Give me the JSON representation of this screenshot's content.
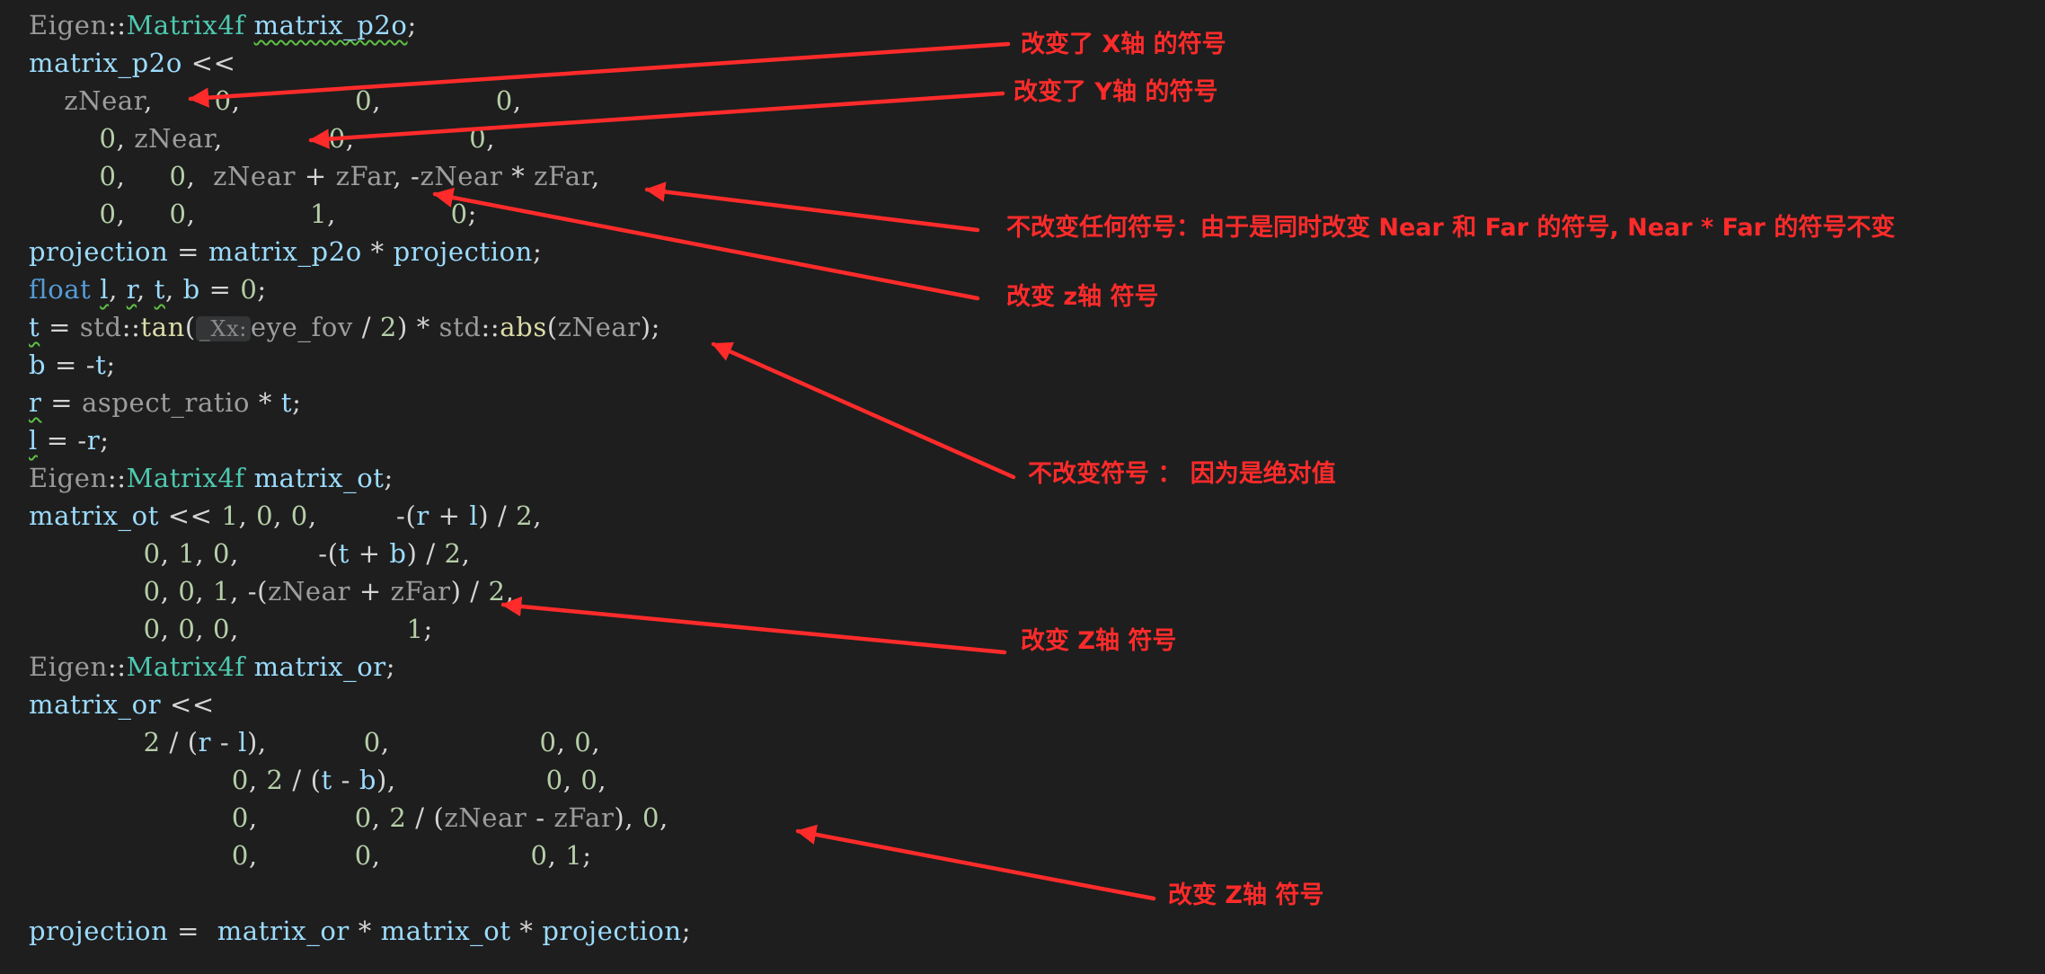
{
  "colors": {
    "background": "#1e1e1e",
    "annotation": "#ff2b2b",
    "namespace": "#9b9b9b",
    "type": "#4ec9b0",
    "variable": "#9cdcfe",
    "operator": "#d4d4d4",
    "number": "#b5cea8",
    "keyword": "#569cd6",
    "function": "#dcdcaa",
    "inlay_hint": "#8a8a8a",
    "squiggle": "#5fbf45"
  },
  "code_lines": [
    [
      {
        "t": "Eigen",
        "c": "ns"
      },
      {
        "t": "::",
        "c": "op"
      },
      {
        "t": "Matrix4f",
        "c": "type"
      },
      {
        "t": " ",
        "c": "op"
      },
      {
        "t": "matrix_p2o",
        "c": "var",
        "sq": true
      },
      {
        "t": ";",
        "c": "op"
      }
    ],
    [
      {
        "t": "matrix_p2o",
        "c": "var"
      },
      {
        "t": " <<",
        "c": "op"
      }
    ],
    [
      {
        "t": "    ",
        "c": "op"
      },
      {
        "t": "zNear",
        "c": "dim"
      },
      {
        "t": ",       ",
        "c": "op"
      },
      {
        "t": "0",
        "c": "num"
      },
      {
        "t": ",             ",
        "c": "op"
      },
      {
        "t": "0",
        "c": "num"
      },
      {
        "t": ",             ",
        "c": "op"
      },
      {
        "t": "0",
        "c": "num"
      },
      {
        "t": ",",
        "c": "op"
      }
    ],
    [
      {
        "t": "        ",
        "c": "op"
      },
      {
        "t": "0",
        "c": "num"
      },
      {
        "t": ", ",
        "c": "op"
      },
      {
        "t": "zNear",
        "c": "dim"
      },
      {
        "t": ",            ",
        "c": "op"
      },
      {
        "t": "0",
        "c": "num"
      },
      {
        "t": ",             ",
        "c": "op"
      },
      {
        "t": "0",
        "c": "num"
      },
      {
        "t": ",",
        "c": "op"
      }
    ],
    [
      {
        "t": "        ",
        "c": "op"
      },
      {
        "t": "0",
        "c": "num"
      },
      {
        "t": ",     ",
        "c": "op"
      },
      {
        "t": "0",
        "c": "num"
      },
      {
        "t": ",  ",
        "c": "op"
      },
      {
        "t": "zNear",
        "c": "dim"
      },
      {
        "t": " + ",
        "c": "op"
      },
      {
        "t": "zFar",
        "c": "dim"
      },
      {
        "t": ", -",
        "c": "op"
      },
      {
        "t": "zNear",
        "c": "dim"
      },
      {
        "t": " * ",
        "c": "op"
      },
      {
        "t": "zFar",
        "c": "dim"
      },
      {
        "t": ",",
        "c": "op"
      }
    ],
    [
      {
        "t": "        ",
        "c": "op"
      },
      {
        "t": "0",
        "c": "num"
      },
      {
        "t": ",     ",
        "c": "op"
      },
      {
        "t": "0",
        "c": "num"
      },
      {
        "t": ",             ",
        "c": "op"
      },
      {
        "t": "1",
        "c": "num"
      },
      {
        "t": ",             ",
        "c": "op"
      },
      {
        "t": "0",
        "c": "num"
      },
      {
        "t": ";",
        "c": "op"
      }
    ],
    [
      {
        "t": "projection",
        "c": "var"
      },
      {
        "t": " = ",
        "c": "op"
      },
      {
        "t": "matrix_p2o",
        "c": "var"
      },
      {
        "t": " * ",
        "c": "op"
      },
      {
        "t": "projection",
        "c": "var"
      },
      {
        "t": ";",
        "c": "op"
      }
    ],
    [
      {
        "t": "float",
        "c": "kw"
      },
      {
        "t": " ",
        "c": "op"
      },
      {
        "t": "l",
        "c": "var",
        "sq": true
      },
      {
        "t": ", ",
        "c": "op"
      },
      {
        "t": "r",
        "c": "var",
        "sq": true
      },
      {
        "t": ", ",
        "c": "op"
      },
      {
        "t": "t",
        "c": "var",
        "sq": true
      },
      {
        "t": ", ",
        "c": "op"
      },
      {
        "t": "b",
        "c": "var"
      },
      {
        "t": " = ",
        "c": "op"
      },
      {
        "t": "0",
        "c": "num"
      },
      {
        "t": ";",
        "c": "op"
      }
    ],
    [
      {
        "t": "t",
        "c": "var",
        "sq": true
      },
      {
        "t": " = ",
        "c": "op"
      },
      {
        "t": "std",
        "c": "ns"
      },
      {
        "t": "::",
        "c": "op"
      },
      {
        "t": "tan",
        "c": "fn"
      },
      {
        "t": "(",
        "c": "op"
      },
      {
        "t": "_Xx:",
        "c": "hint"
      },
      {
        "t": "eye_fov",
        "c": "dim"
      },
      {
        "t": " / ",
        "c": "op"
      },
      {
        "t": "2",
        "c": "num"
      },
      {
        "t": ") * ",
        "c": "op"
      },
      {
        "t": "std",
        "c": "ns"
      },
      {
        "t": "::",
        "c": "op"
      },
      {
        "t": "abs",
        "c": "fn"
      },
      {
        "t": "(",
        "c": "op"
      },
      {
        "t": "zNear",
        "c": "dim"
      },
      {
        "t": ");",
        "c": "op"
      }
    ],
    [
      {
        "t": "b",
        "c": "var"
      },
      {
        "t": " = -",
        "c": "op"
      },
      {
        "t": "t",
        "c": "var"
      },
      {
        "t": ";",
        "c": "op"
      }
    ],
    [
      {
        "t": "r",
        "c": "var",
        "sq": true
      },
      {
        "t": " = ",
        "c": "op"
      },
      {
        "t": "aspect_ratio",
        "c": "dim"
      },
      {
        "t": " * ",
        "c": "op"
      },
      {
        "t": "t",
        "c": "var"
      },
      {
        "t": ";",
        "c": "op"
      }
    ],
    [
      {
        "t": "l",
        "c": "var",
        "sq": true
      },
      {
        "t": " = -",
        "c": "op"
      },
      {
        "t": "r",
        "c": "var"
      },
      {
        "t": ";",
        "c": "op"
      }
    ],
    [
      {
        "t": "Eigen",
        "c": "ns"
      },
      {
        "t": "::",
        "c": "op"
      },
      {
        "t": "Matrix4f",
        "c": "type"
      },
      {
        "t": " ",
        "c": "op"
      },
      {
        "t": "matrix_ot",
        "c": "var"
      },
      {
        "t": ";",
        "c": "op"
      }
    ],
    [
      {
        "t": "matrix_ot",
        "c": "var"
      },
      {
        "t": " << ",
        "c": "op"
      },
      {
        "t": "1",
        "c": "num"
      },
      {
        "t": ", ",
        "c": "op"
      },
      {
        "t": "0",
        "c": "num"
      },
      {
        "t": ", ",
        "c": "op"
      },
      {
        "t": "0",
        "c": "num"
      },
      {
        "t": ",         -(",
        "c": "op"
      },
      {
        "t": "r",
        "c": "var"
      },
      {
        "t": " + ",
        "c": "op"
      },
      {
        "t": "l",
        "c": "var"
      },
      {
        "t": ") / ",
        "c": "op"
      },
      {
        "t": "2",
        "c": "num"
      },
      {
        "t": ",",
        "c": "op"
      }
    ],
    [
      {
        "t": "             ",
        "c": "op"
      },
      {
        "t": "0",
        "c": "num"
      },
      {
        "t": ", ",
        "c": "op"
      },
      {
        "t": "1",
        "c": "num"
      },
      {
        "t": ", ",
        "c": "op"
      },
      {
        "t": "0",
        "c": "num"
      },
      {
        "t": ",         -(",
        "c": "op"
      },
      {
        "t": "t",
        "c": "var"
      },
      {
        "t": " + ",
        "c": "op"
      },
      {
        "t": "b",
        "c": "var"
      },
      {
        "t": ") / ",
        "c": "op"
      },
      {
        "t": "2",
        "c": "num"
      },
      {
        "t": ",",
        "c": "op"
      }
    ],
    [
      {
        "t": "             ",
        "c": "op"
      },
      {
        "t": "0",
        "c": "num"
      },
      {
        "t": ", ",
        "c": "op"
      },
      {
        "t": "0",
        "c": "num"
      },
      {
        "t": ", ",
        "c": "op"
      },
      {
        "t": "1",
        "c": "num"
      },
      {
        "t": ", -(",
        "c": "op"
      },
      {
        "t": "zNear",
        "c": "dim"
      },
      {
        "t": " + ",
        "c": "op"
      },
      {
        "t": "zFar",
        "c": "dim"
      },
      {
        "t": ") / ",
        "c": "op"
      },
      {
        "t": "2",
        "c": "num"
      },
      {
        "t": ",",
        "c": "op"
      }
    ],
    [
      {
        "t": "             ",
        "c": "op"
      },
      {
        "t": "0",
        "c": "num"
      },
      {
        "t": ", ",
        "c": "op"
      },
      {
        "t": "0",
        "c": "num"
      },
      {
        "t": ", ",
        "c": "op"
      },
      {
        "t": "0",
        "c": "num"
      },
      {
        "t": ",                   ",
        "c": "op"
      },
      {
        "t": "1",
        "c": "num"
      },
      {
        "t": ";",
        "c": "op"
      }
    ],
    [
      {
        "t": "Eigen",
        "c": "ns"
      },
      {
        "t": "::",
        "c": "op"
      },
      {
        "t": "Matrix4f",
        "c": "type"
      },
      {
        "t": " ",
        "c": "op"
      },
      {
        "t": "matrix_or",
        "c": "var"
      },
      {
        "t": ";",
        "c": "op"
      }
    ],
    [
      {
        "t": "matrix_or",
        "c": "var"
      },
      {
        "t": " <<",
        "c": "op"
      }
    ],
    [
      {
        "t": "             ",
        "c": "op"
      },
      {
        "t": "2",
        "c": "num"
      },
      {
        "t": " / (",
        "c": "op"
      },
      {
        "t": "r",
        "c": "var"
      },
      {
        "t": " - ",
        "c": "op"
      },
      {
        "t": "l",
        "c": "var"
      },
      {
        "t": "),           ",
        "c": "op"
      },
      {
        "t": "0",
        "c": "num"
      },
      {
        "t": ",                 ",
        "c": "op"
      },
      {
        "t": "0",
        "c": "num"
      },
      {
        "t": ", ",
        "c": "op"
      },
      {
        "t": "0",
        "c": "num"
      },
      {
        "t": ",",
        "c": "op"
      }
    ],
    [
      {
        "t": "                       ",
        "c": "op"
      },
      {
        "t": "0",
        "c": "num"
      },
      {
        "t": ", ",
        "c": "op"
      },
      {
        "t": "2",
        "c": "num"
      },
      {
        "t": " / (",
        "c": "op"
      },
      {
        "t": "t",
        "c": "var"
      },
      {
        "t": " - ",
        "c": "op"
      },
      {
        "t": "b",
        "c": "var"
      },
      {
        "t": "),                 ",
        "c": "op"
      },
      {
        "t": "0",
        "c": "num"
      },
      {
        "t": ", ",
        "c": "op"
      },
      {
        "t": "0",
        "c": "num"
      },
      {
        "t": ",",
        "c": "op"
      }
    ],
    [
      {
        "t": "                       ",
        "c": "op"
      },
      {
        "t": "0",
        "c": "num"
      },
      {
        "t": ",           ",
        "c": "op"
      },
      {
        "t": "0",
        "c": "num"
      },
      {
        "t": ", ",
        "c": "op"
      },
      {
        "t": "2",
        "c": "num"
      },
      {
        "t": " / (",
        "c": "op"
      },
      {
        "t": "zNear",
        "c": "dim"
      },
      {
        "t": " - ",
        "c": "op"
      },
      {
        "t": "zFar",
        "c": "dim"
      },
      {
        "t": "), ",
        "c": "op"
      },
      {
        "t": "0",
        "c": "num"
      },
      {
        "t": ",",
        "c": "op"
      }
    ],
    [
      {
        "t": "                       ",
        "c": "op"
      },
      {
        "t": "0",
        "c": "num"
      },
      {
        "t": ",           ",
        "c": "op"
      },
      {
        "t": "0",
        "c": "num"
      },
      {
        "t": ",                 ",
        "c": "op"
      },
      {
        "t": "0",
        "c": "num"
      },
      {
        "t": ", ",
        "c": "op"
      },
      {
        "t": "1",
        "c": "num"
      },
      {
        "t": ";",
        "c": "op"
      }
    ],
    [],
    [
      {
        "t": "projection",
        "c": "var"
      },
      {
        "t": " =  ",
        "c": "op"
      },
      {
        "t": "matrix_or",
        "c": "var"
      },
      {
        "t": " * ",
        "c": "op"
      },
      {
        "t": "matrix_ot",
        "c": "var"
      },
      {
        "t": " * ",
        "c": "op"
      },
      {
        "t": "projection",
        "c": "var"
      },
      {
        "t": ";",
        "c": "op"
      }
    ]
  ],
  "annotations": {
    "x_axis": "改变了 X轴 的符号",
    "y_axis": "改变了 Y轴 的符号",
    "no_change": "不改变任何符号：由于是同时改变 Near 和 Far 的符号, Near * Far  的符号不变",
    "z_axis_1": "改变 z轴 符号",
    "abs_value": "不改变符号 ： 因为是绝对值",
    "z_axis_2": "改变 Z轴 符号",
    "z_axis_3": "改变 Z轴 符号"
  }
}
